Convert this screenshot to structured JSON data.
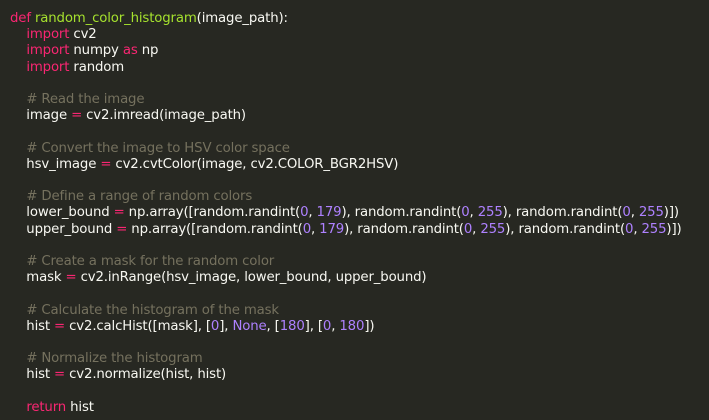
{
  "code": {
    "lines": [
      [
        {
          "t": "def ",
          "c": "kw"
        },
        {
          "t": "random_color_histogram",
          "c": "fn"
        },
        {
          "t": "(image_path):",
          "c": "pl"
        }
      ],
      [
        {
          "t": "    ",
          "c": "pl"
        },
        {
          "t": "import",
          "c": "kw"
        },
        {
          "t": " cv2",
          "c": "pl"
        }
      ],
      [
        {
          "t": "    ",
          "c": "pl"
        },
        {
          "t": "import",
          "c": "kw"
        },
        {
          "t": " numpy ",
          "c": "pl"
        },
        {
          "t": "as",
          "c": "kw"
        },
        {
          "t": " np",
          "c": "pl"
        }
      ],
      [
        {
          "t": "    ",
          "c": "pl"
        },
        {
          "t": "import",
          "c": "kw"
        },
        {
          "t": " random",
          "c": "pl"
        }
      ],
      [],
      [
        {
          "t": "    ",
          "c": "pl"
        },
        {
          "t": "# Read the image",
          "c": "cm"
        }
      ],
      [
        {
          "t": "    image ",
          "c": "pl"
        },
        {
          "t": "=",
          "c": "op"
        },
        {
          "t": " cv2.imread(image_path)",
          "c": "pl"
        }
      ],
      [],
      [
        {
          "t": "    ",
          "c": "pl"
        },
        {
          "t": "# Convert the image to HSV color space",
          "c": "cm"
        }
      ],
      [
        {
          "t": "    hsv_image ",
          "c": "pl"
        },
        {
          "t": "=",
          "c": "op"
        },
        {
          "t": " cv2.cvtColor(image, cv2.COLOR_BGR2HSV)",
          "c": "pl"
        }
      ],
      [],
      [
        {
          "t": "    ",
          "c": "pl"
        },
        {
          "t": "# Define a range of random colors",
          "c": "cm"
        }
      ],
      [
        {
          "t": "    lower_bound ",
          "c": "pl"
        },
        {
          "t": "=",
          "c": "op"
        },
        {
          "t": " np.array([random.randint(",
          "c": "pl"
        },
        {
          "t": "0",
          "c": "nm"
        },
        {
          "t": ", ",
          "c": "pl"
        },
        {
          "t": "179",
          "c": "nm"
        },
        {
          "t": "), random.randint(",
          "c": "pl"
        },
        {
          "t": "0",
          "c": "nm"
        },
        {
          "t": ", ",
          "c": "pl"
        },
        {
          "t": "255",
          "c": "nm"
        },
        {
          "t": "), random.randint(",
          "c": "pl"
        },
        {
          "t": "0",
          "c": "nm"
        },
        {
          "t": ", ",
          "c": "pl"
        },
        {
          "t": "255",
          "c": "nm"
        },
        {
          "t": ")])",
          "c": "pl"
        }
      ],
      [
        {
          "t": "    upper_bound ",
          "c": "pl"
        },
        {
          "t": "=",
          "c": "op"
        },
        {
          "t": " np.array([random.randint(",
          "c": "pl"
        },
        {
          "t": "0",
          "c": "nm"
        },
        {
          "t": ", ",
          "c": "pl"
        },
        {
          "t": "179",
          "c": "nm"
        },
        {
          "t": "), random.randint(",
          "c": "pl"
        },
        {
          "t": "0",
          "c": "nm"
        },
        {
          "t": ", ",
          "c": "pl"
        },
        {
          "t": "255",
          "c": "nm"
        },
        {
          "t": "), random.randint(",
          "c": "pl"
        },
        {
          "t": "0",
          "c": "nm"
        },
        {
          "t": ", ",
          "c": "pl"
        },
        {
          "t": "255",
          "c": "nm"
        },
        {
          "t": ")])",
          "c": "pl"
        }
      ],
      [],
      [
        {
          "t": "    ",
          "c": "pl"
        },
        {
          "t": "# Create a mask for the random color",
          "c": "cm"
        }
      ],
      [
        {
          "t": "    mask ",
          "c": "pl"
        },
        {
          "t": "=",
          "c": "op"
        },
        {
          "t": " cv2.inRange(hsv_image, lower_bound, upper_bound)",
          "c": "pl"
        }
      ],
      [],
      [
        {
          "t": "    ",
          "c": "pl"
        },
        {
          "t": "# Calculate the histogram of the mask",
          "c": "cm"
        }
      ],
      [
        {
          "t": "    hist ",
          "c": "pl"
        },
        {
          "t": "=",
          "c": "op"
        },
        {
          "t": " cv2.calcHist([mask], [",
          "c": "pl"
        },
        {
          "t": "0",
          "c": "nm"
        },
        {
          "t": "], ",
          "c": "pl"
        },
        {
          "t": "None",
          "c": "nm"
        },
        {
          "t": ", [",
          "c": "pl"
        },
        {
          "t": "180",
          "c": "nm"
        },
        {
          "t": "], [",
          "c": "pl"
        },
        {
          "t": "0",
          "c": "nm"
        },
        {
          "t": ", ",
          "c": "pl"
        },
        {
          "t": "180",
          "c": "nm"
        },
        {
          "t": "])",
          "c": "pl"
        }
      ],
      [],
      [
        {
          "t": "    ",
          "c": "pl"
        },
        {
          "t": "# Normalize the histogram",
          "c": "cm"
        }
      ],
      [
        {
          "t": "    hist ",
          "c": "pl"
        },
        {
          "t": "=",
          "c": "op"
        },
        {
          "t": " cv2.normalize(hist, hist)",
          "c": "pl"
        }
      ],
      [],
      [
        {
          "t": "    ",
          "c": "pl"
        },
        {
          "t": "return",
          "c": "kw"
        },
        {
          "t": " hist",
          "c": "pl"
        }
      ]
    ]
  },
  "colors": {
    "background": "#272822",
    "keyword": "#f92672",
    "function": "#a6e22e",
    "comment": "#75715e",
    "number": "#ae81ff",
    "text": "#f8f8f2"
  }
}
